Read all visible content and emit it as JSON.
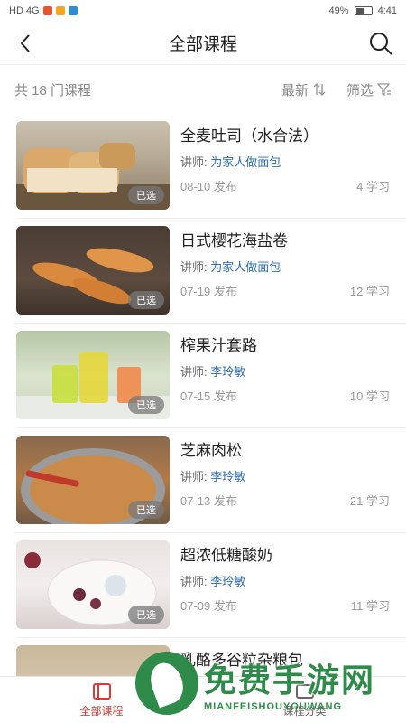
{
  "status": {
    "left": "HD 4G",
    "battery": "49%",
    "time": "4:41"
  },
  "header": {
    "title": "全部课程"
  },
  "filters": {
    "count": "共 18 门课程",
    "sort_label": "最新",
    "filter_label": "筛选"
  },
  "courses": [
    {
      "title": "全麦吐司（水合法）",
      "teacher_prefix": "讲师:",
      "teacher": "为家人做面包",
      "date": "08-10 发布",
      "learners": "4 学习",
      "badge": "已选"
    },
    {
      "title": "日式樱花海盐卷",
      "teacher_prefix": "讲师:",
      "teacher": "为家人做面包",
      "date": "07-19 发布",
      "learners": "12 学习",
      "badge": "已选"
    },
    {
      "title": "榨果汁套路",
      "teacher_prefix": "讲师:",
      "teacher": "李玲敏",
      "date": "07-15 发布",
      "learners": "10 学习",
      "badge": "已选"
    },
    {
      "title": "芝麻肉松",
      "teacher_prefix": "讲师:",
      "teacher": "李玲敏",
      "date": "07-13 发布",
      "learners": "21 学习",
      "badge": "已选"
    },
    {
      "title": "超浓低糖酸奶",
      "teacher_prefix": "讲师:",
      "teacher": "李玲敏",
      "date": "07-09 发布",
      "learners": "11 学习",
      "badge": "已选"
    },
    {
      "title": "乳酪多谷粒杂粮包"
    }
  ],
  "tabs": [
    {
      "label": "全部课程"
    },
    {
      "label": "课程分类"
    }
  ],
  "watermark": {
    "cn": "免费手游网",
    "en": "MIANFEISHOUYOUWANG"
  }
}
